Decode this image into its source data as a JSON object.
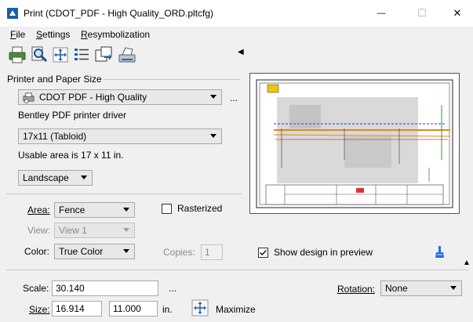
{
  "window": {
    "title": "Print  (CDOT_PDF - High Quality_ORD.pltcfg)",
    "minimize_glyph": "—",
    "maximize_glyph": "☐",
    "close_glyph": "✕"
  },
  "menu": [
    {
      "label": "File",
      "accel": "F",
      "rest": "ile"
    },
    {
      "label": "Settings",
      "accel": "S",
      "rest": "ettings"
    },
    {
      "label": "Resymbolization",
      "accel": "R",
      "rest": "esymbolization"
    }
  ],
  "toolbar": {
    "icons": [
      "print-icon",
      "preview-icon",
      "fit-icon",
      "list-icon",
      "export-icon",
      "printer-setup-icon"
    ],
    "collapse_glyph": "◀"
  },
  "printer_paper": {
    "section_label": "Printer and Paper Size",
    "printer_value": "CDOT PDF - High Quality",
    "more_button": "...",
    "driver_text": "Bentley PDF printer driver",
    "paper_value": "17x11 (Tabloid)",
    "usable_area": "Usable area is 17 x 11 in.",
    "orientation_value": "Landscape"
  },
  "options": {
    "area_label": "Area:",
    "area_value": "Fence",
    "rasterized_label": "Rasterized",
    "rasterized_checked": false,
    "view_label": "View:",
    "view_value": "View 1",
    "color_label": "Color:",
    "color_value": "True Color",
    "copies_label": "Copies:",
    "copies_value": "1",
    "show_design_label": "Show design in preview",
    "show_design_checked": true
  },
  "scale_section": {
    "scale_label": "Scale:",
    "scale_value": "30.140",
    "scale_more": "...",
    "rotation_label": "Rotation:",
    "rotation_value": "None",
    "size_label": "Size:",
    "size_width": "16.914",
    "size_height": "11.000",
    "size_unit": "in.",
    "maximize_label": "Maximize",
    "expand_glyph": "▲"
  },
  "colors": {
    "accent_blue": "#1a73c8",
    "brush_blue": "#2a6fd6"
  }
}
